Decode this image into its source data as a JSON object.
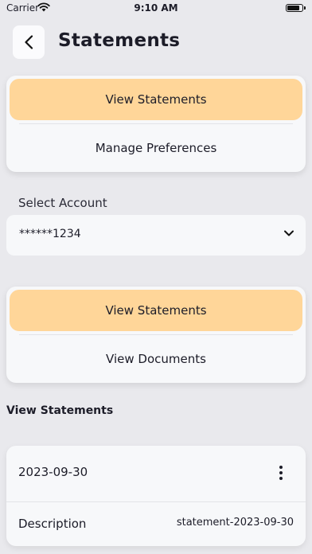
{
  "status_bar": {
    "carrier": "Carrier",
    "time": "9:10 AM"
  },
  "header": {
    "title": "Statements"
  },
  "top_segment": {
    "options": [
      "View Statements",
      "Manage Preferences"
    ],
    "selected": "View Statements"
  },
  "account": {
    "label": "Select Account",
    "selected_value": "******1234"
  },
  "doc_segment": {
    "options": [
      "View Statements",
      "View Documents"
    ],
    "selected": "View Statements"
  },
  "section": {
    "title": "View Statements"
  },
  "statements": [
    {
      "date": "2023-09-30",
      "description_label": "Description",
      "description_value": "statement-2023-09-30"
    }
  ],
  "colors": {
    "background": "#e9e9ed",
    "card": "#f7f8fa",
    "active_segment": "#ffd699",
    "text": "#1c1c28"
  }
}
